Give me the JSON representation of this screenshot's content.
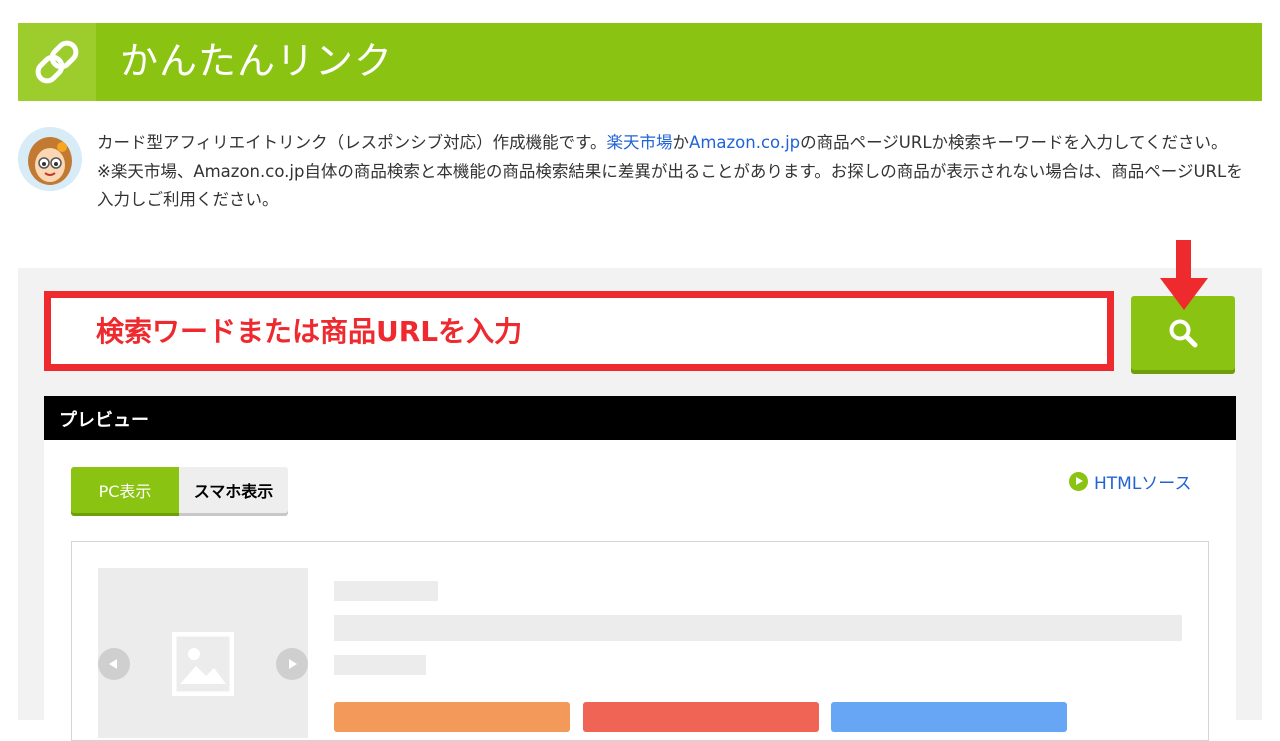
{
  "header": {
    "title": "かんたんリンク",
    "icon": "link-chain-icon"
  },
  "intro": {
    "line1_prefix": "カード型アフィリエイトリンク（レスポンシブ対応）作成機能です。",
    "rakuten_link": "楽天市場",
    "connector": "か",
    "amazon_link": "Amazon.co.jp",
    "line1_suffix": "の商品ページURLか検索キーワードを入力してください。",
    "note": "※楽天市場、Amazon.co.jp自体の商品検索と本機能の商品検索結果に差異が出ることがあります。お探しの商品が表示されない場合は、商品ページURLを入力しご利用ください。"
  },
  "search": {
    "placeholder": "検索ワードまたは商品URLを入力",
    "button_icon": "search-icon",
    "highlight_color": "#ee2a2f"
  },
  "preview": {
    "title": "プレビュー",
    "tabs": [
      {
        "label": "PC表示",
        "active": true
      },
      {
        "label": "スマホ表示",
        "active": false
      }
    ],
    "html_source_label": "HTMLソース"
  },
  "colors": {
    "accent": "#8ac311",
    "link": "#1f63d6",
    "annotation": "#ee2a2f",
    "placeholder_buttons": [
      "#f39a5a",
      "#ef6455",
      "#66a6f4"
    ]
  }
}
